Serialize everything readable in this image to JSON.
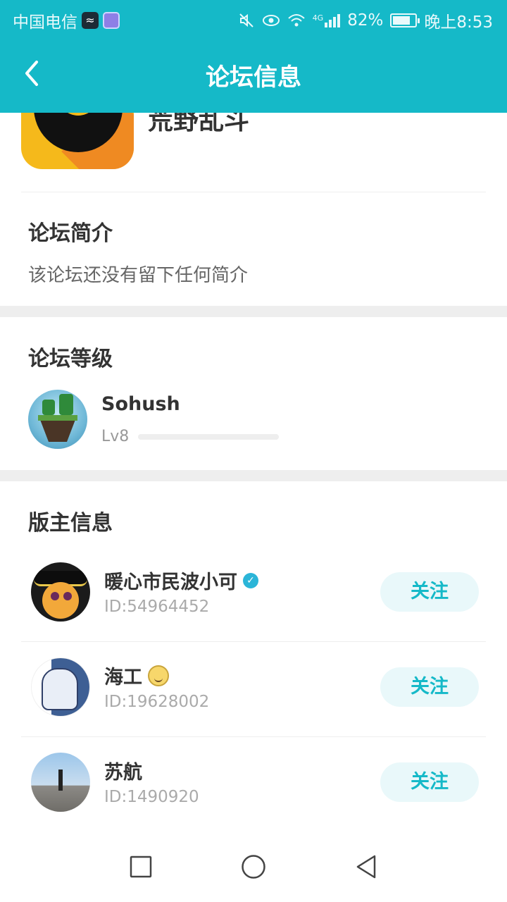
{
  "status_bar": {
    "carrier": "中国电信",
    "signal_type": "4G",
    "battery_percent": "82%",
    "battery_level": 0.82,
    "time": "晚上8:53",
    "icons": [
      "mute-icon",
      "eye-icon",
      "wifi-icon",
      "signal-icon",
      "battery-icon"
    ]
  },
  "header": {
    "title": "论坛信息",
    "back_icon": "back-arrow-icon",
    "color": "#15b9c8"
  },
  "forum": {
    "name": "荒野乱斗",
    "intro_title": "论坛简介",
    "intro_text": "该论坛还没有留下任何简介"
  },
  "level": {
    "title": "论坛等级",
    "username": "Sohush",
    "level_label": "Lv8",
    "progress": 0.0
  },
  "moderators": {
    "title": "版主信息",
    "follow_label": "关注",
    "items": [
      {
        "name": "暖心市民波小可",
        "id": "ID:54964452",
        "badge": "verified-icon"
      },
      {
        "name": "海工",
        "id": "ID:19628002",
        "badge": "emoji-face-icon"
      },
      {
        "name": "苏航",
        "id": "ID:1490920",
        "badge": ""
      }
    ]
  },
  "system_nav": {
    "buttons": [
      "recents-square-icon",
      "home-circle-icon",
      "back-triangle-icon"
    ]
  }
}
